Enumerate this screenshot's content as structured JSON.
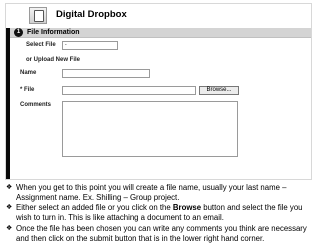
{
  "app": {
    "title": "Digital Dropbox",
    "icon": "dropbox-icon"
  },
  "section": {
    "step": "1",
    "title": "File Information"
  },
  "form": {
    "select_file_label": "Select File",
    "select_file_value": "-",
    "upload_label": "or Upload New File",
    "name_label": "Name",
    "file_label": "* File",
    "browse_label": "Browse...",
    "comments_label": "Comments"
  },
  "notes": [
    {
      "before": "When you get to this point you will create a file name, usually your last name – Assignment name.  Ex. Shilling – Group project.",
      "bold": "",
      "after": ""
    },
    {
      "before": "Either select an added file or you click on the ",
      "bold": "Browse",
      "after": " button and select the file you wish to turn in. This is like attaching a document to an email."
    },
    {
      "before": "Once the file has been chosen you can write any comments you think are necessary and then click on the submit button that is in the lower right hand corner.",
      "bold": "",
      "after": ""
    }
  ],
  "bullet_glyph": "❖"
}
